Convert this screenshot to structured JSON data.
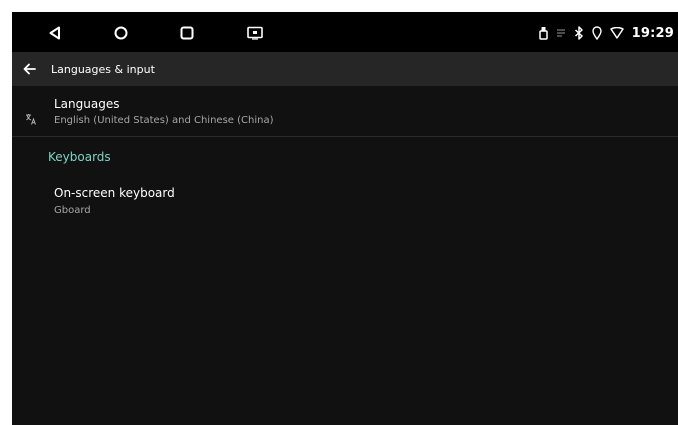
{
  "status_bar": {
    "time": "19:29",
    "icons": [
      "usb-icon",
      "notification-icon",
      "bluetooth-icon",
      "location-icon",
      "wifi-icon"
    ]
  },
  "nav_bar": {
    "buttons": [
      "back-triangle-icon",
      "home-circle-icon",
      "recents-square-icon",
      "screen-icon"
    ]
  },
  "app_bar": {
    "title": "Languages & input"
  },
  "languages_item": {
    "title": "Languages",
    "summary": "English (United States) and Chinese (China)",
    "icon": "translate-icon"
  },
  "keyboards_category": {
    "title": "Keyboards"
  },
  "onscreen_keyboard_item": {
    "title": "On-screen keyboard",
    "summary": "Gboard"
  },
  "colors": {
    "background": "#111111",
    "app_bar": "#262626",
    "accent": "#7ed4c4",
    "secondary_text": "#a6a6a6"
  }
}
